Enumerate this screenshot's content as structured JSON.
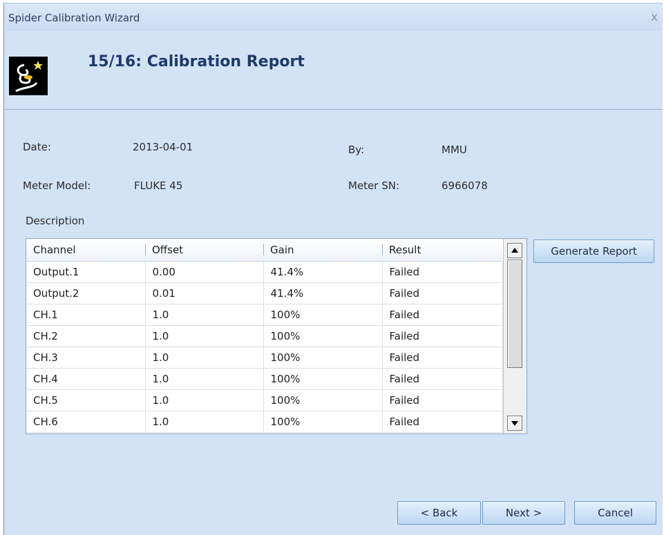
{
  "window": {
    "title": "Spider Calibration Wizard",
    "close_glyph": "x"
  },
  "header": {
    "step_title": "15/16: Calibration Report",
    "logo_icon": "wizard-logo-icon"
  },
  "fields": {
    "date_label": "Date:",
    "date_value": "2013-04-01",
    "by_label": "By:",
    "by_value": "MMU",
    "meter_model_label": "Meter Model:",
    "meter_model_value": "FLUKE 45",
    "meter_sn_label": "Meter SN:",
    "meter_sn_value": "6966078",
    "description_label": "Description"
  },
  "table": {
    "columns": [
      "Channel",
      "Offset",
      "Gain",
      "Result"
    ],
    "rows": [
      [
        "Output.1",
        "0.00",
        "41.4%",
        "Failed"
      ],
      [
        "Output.2",
        "0.01",
        "41.4%",
        "Failed"
      ],
      [
        "CH.1",
        "1.0",
        "100%",
        "Failed"
      ],
      [
        "CH.2",
        "1.0",
        "100%",
        "Failed"
      ],
      [
        "CH.3",
        "1.0",
        "100%",
        "Failed"
      ],
      [
        "CH.4",
        "1.0",
        "100%",
        "Failed"
      ],
      [
        "CH.5",
        "1.0",
        "100%",
        "Failed"
      ],
      [
        "CH.6",
        "1.0",
        "100%",
        "Failed"
      ]
    ]
  },
  "buttons": {
    "generate_report": "Generate Report",
    "back": "< Back",
    "next": "Next >",
    "cancel": "Cancel"
  },
  "colors": {
    "window_bg": "#d3e3f6",
    "title_text": "#1e3a68",
    "button_border": "#6f9bc6"
  }
}
